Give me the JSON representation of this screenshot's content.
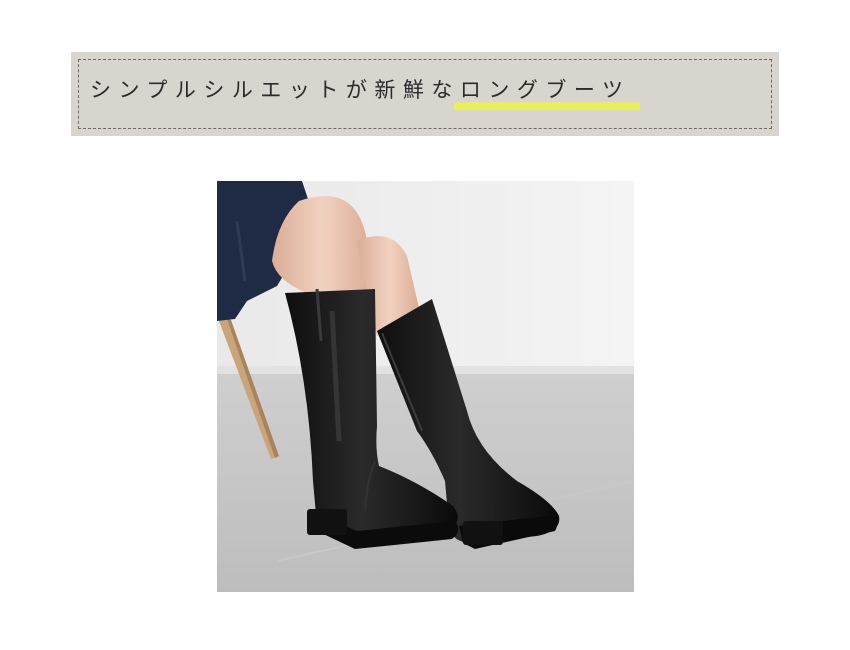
{
  "banner": {
    "text_plain": "シンプルシルエットが新鮮な",
    "text_highlight": "ロングブーツ",
    "highlight_color": "#e8ef5e",
    "background_color": "#d8d4ce"
  },
  "photo": {
    "subject": "black-long-boots-photo"
  }
}
